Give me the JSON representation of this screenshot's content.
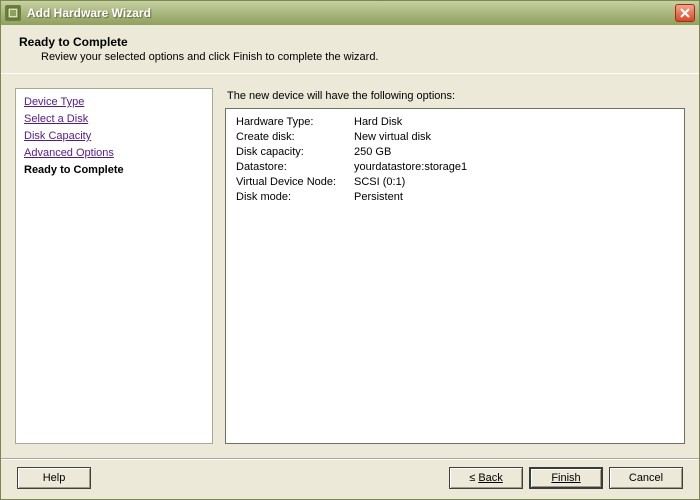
{
  "titlebar": {
    "title": "Add Hardware Wizard"
  },
  "header": {
    "title": "Ready to Complete",
    "subtitle": "Review your selected options and click Finish to complete the wizard."
  },
  "nav": {
    "items": [
      {
        "label": "Device Type",
        "current": false
      },
      {
        "label": "Select a Disk",
        "current": false
      },
      {
        "label": "Disk Capacity",
        "current": false
      },
      {
        "label": "Advanced Options",
        "current": false
      },
      {
        "label": "Ready to Complete",
        "current": true
      }
    ]
  },
  "content": {
    "intro": "The new device will have the following options:",
    "options": [
      {
        "label": "Hardware Type:",
        "value": "Hard Disk"
      },
      {
        "label": "Create disk:",
        "value": "New virtual disk"
      },
      {
        "label": "Disk capacity:",
        "value": "250 GB"
      },
      {
        "label": "Datastore:",
        "value": "yourdatastore:storage1"
      },
      {
        "label": "Virtual Device Node:",
        "value": "SCSI (0:1)"
      },
      {
        "label": "Disk mode:",
        "value": "Persistent"
      }
    ]
  },
  "footer": {
    "help": "Help",
    "back_prefix": "≤ ",
    "back": "Back",
    "finish": "Finish",
    "cancel": "Cancel"
  }
}
